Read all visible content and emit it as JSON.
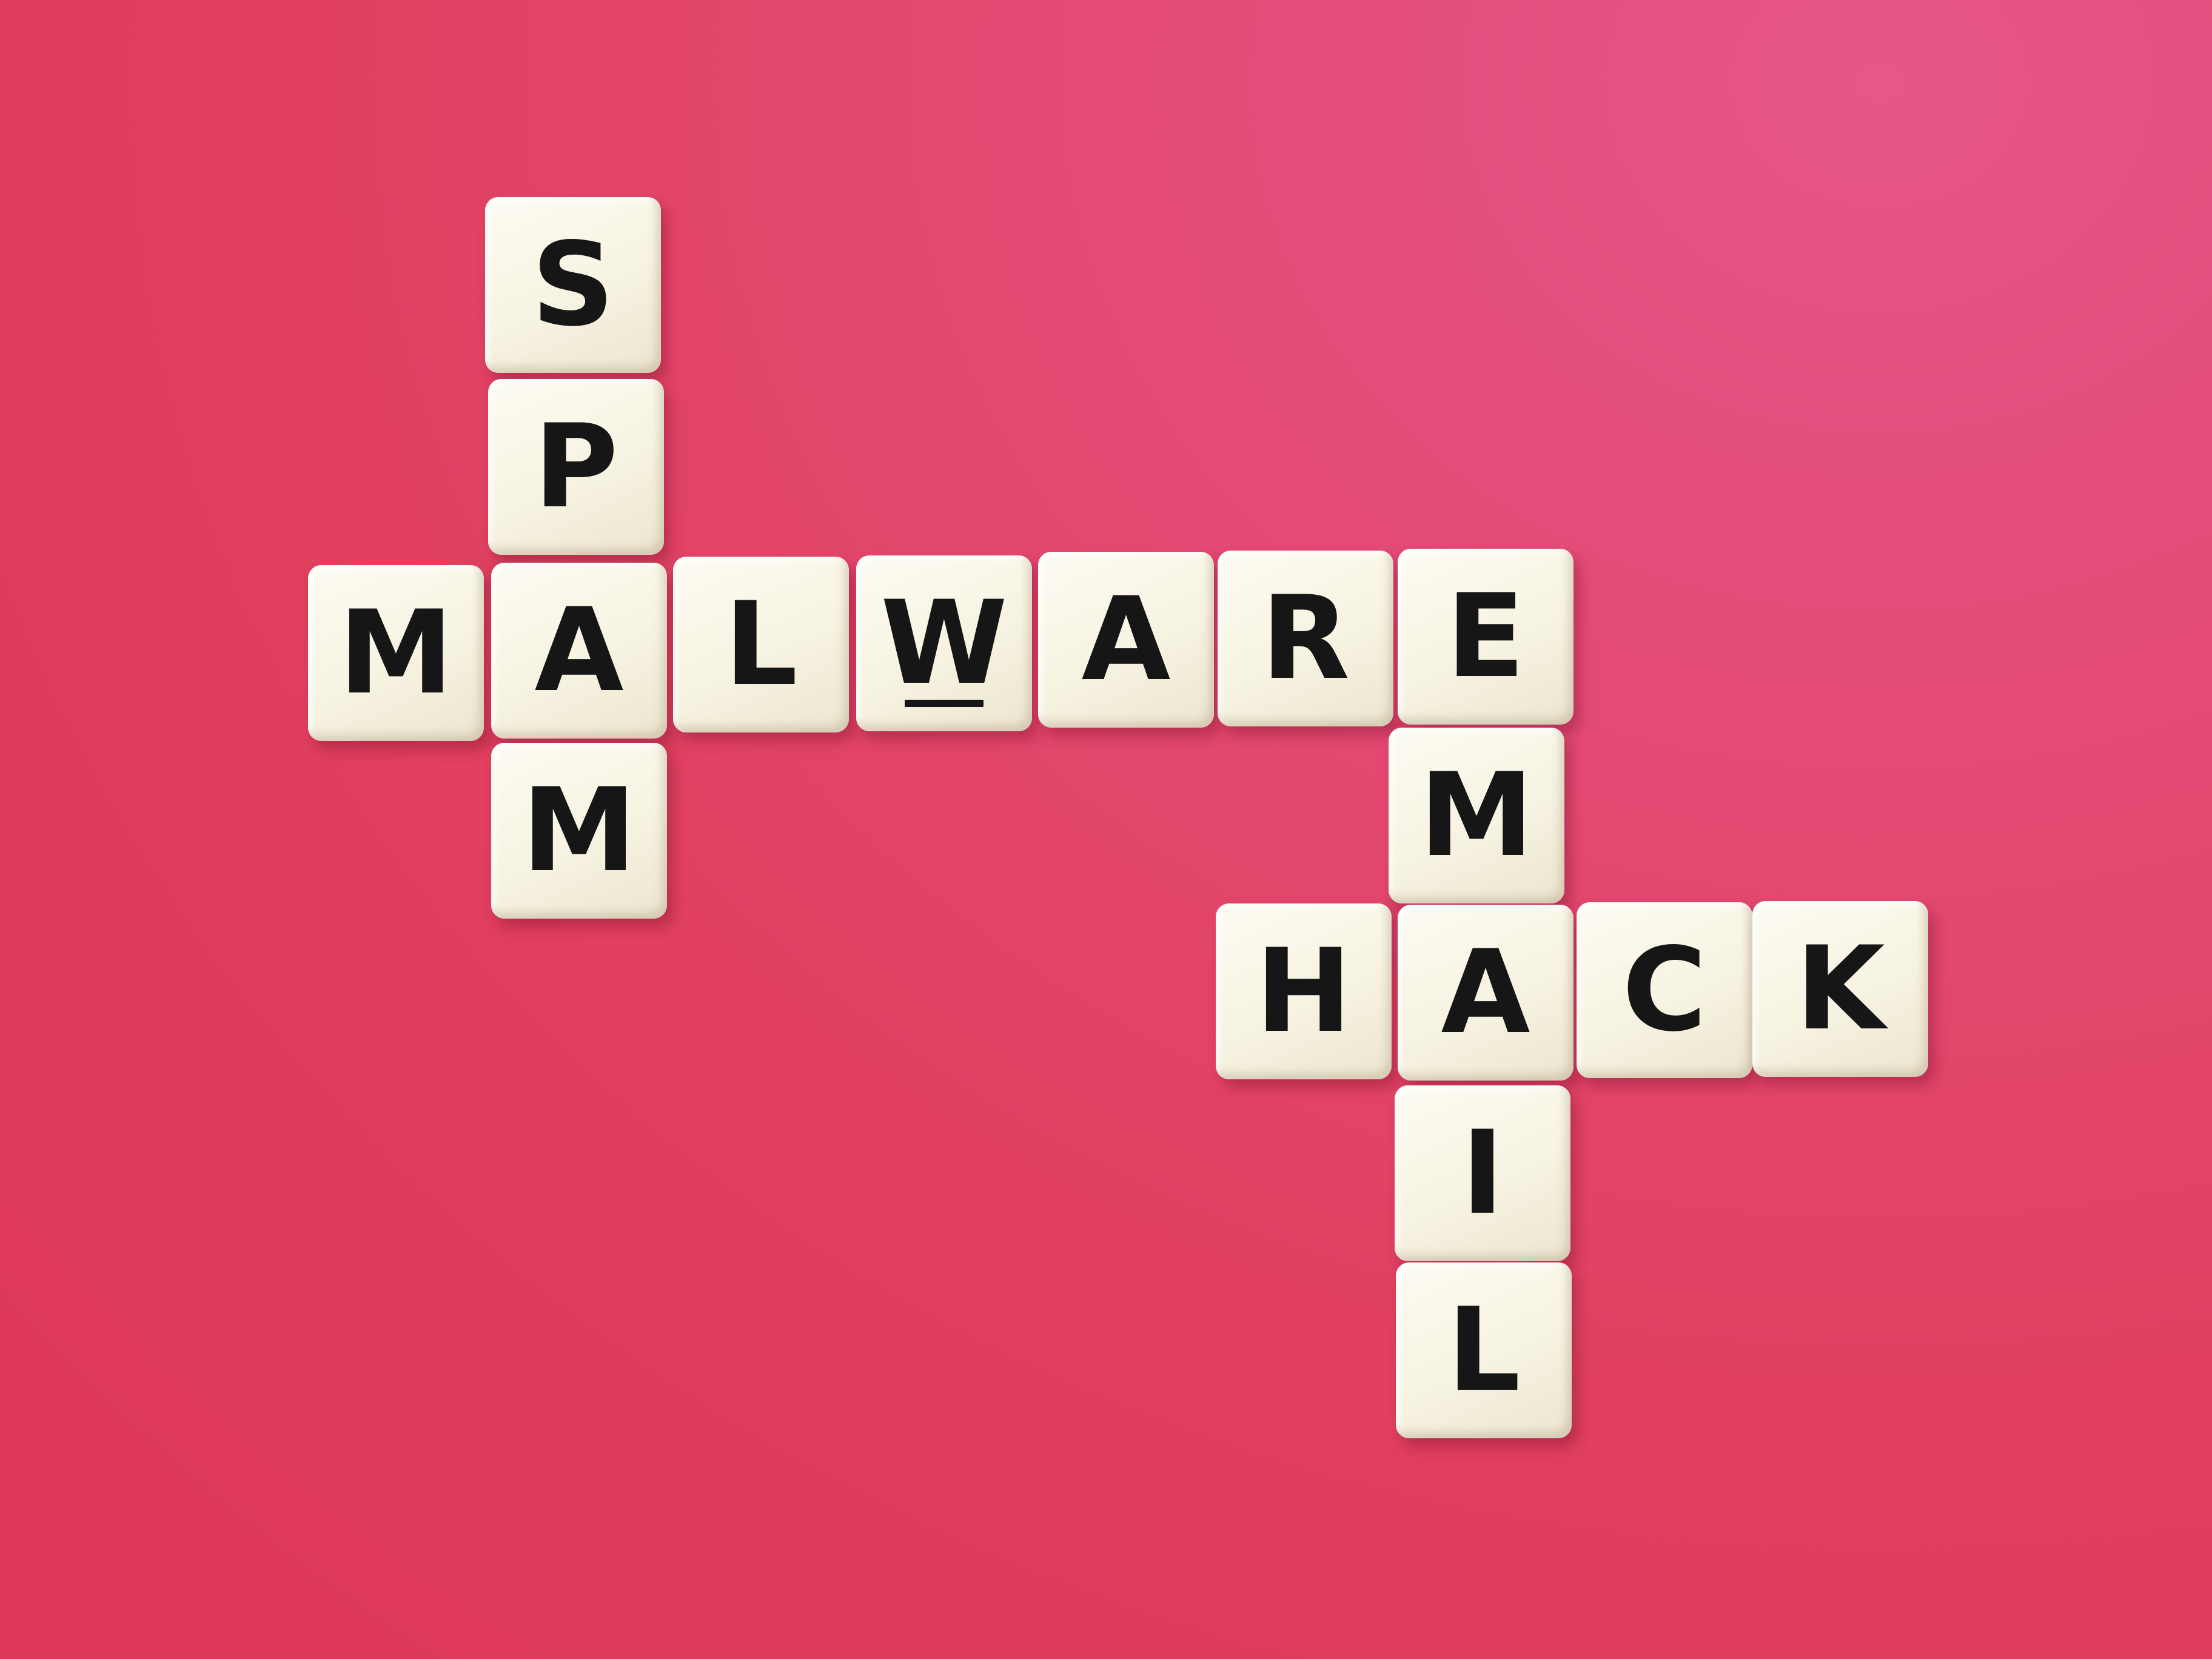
{
  "background_color": "#e1405f",
  "tile_color": "#f7f3e2",
  "letter_color": "#161616",
  "words": [
    {
      "id": "spam",
      "text": "SPAM"
    },
    {
      "id": "malware",
      "text": "MALWARE"
    },
    {
      "id": "email",
      "text": "EMAIL"
    },
    {
      "id": "hack",
      "text": "HACK"
    }
  ],
  "tiles": [
    {
      "letter": "S"
    },
    {
      "letter": "P"
    },
    {
      "letter": "M"
    },
    {
      "letter": "A"
    },
    {
      "letter": "L"
    },
    {
      "letter": "W",
      "underlined": true
    },
    {
      "letter": "A"
    },
    {
      "letter": "R"
    },
    {
      "letter": "E"
    },
    {
      "letter": "M"
    },
    {
      "letter": "M"
    },
    {
      "letter": "H"
    },
    {
      "letter": "A"
    },
    {
      "letter": "C"
    },
    {
      "letter": "K"
    },
    {
      "letter": "I"
    },
    {
      "letter": "L"
    }
  ]
}
